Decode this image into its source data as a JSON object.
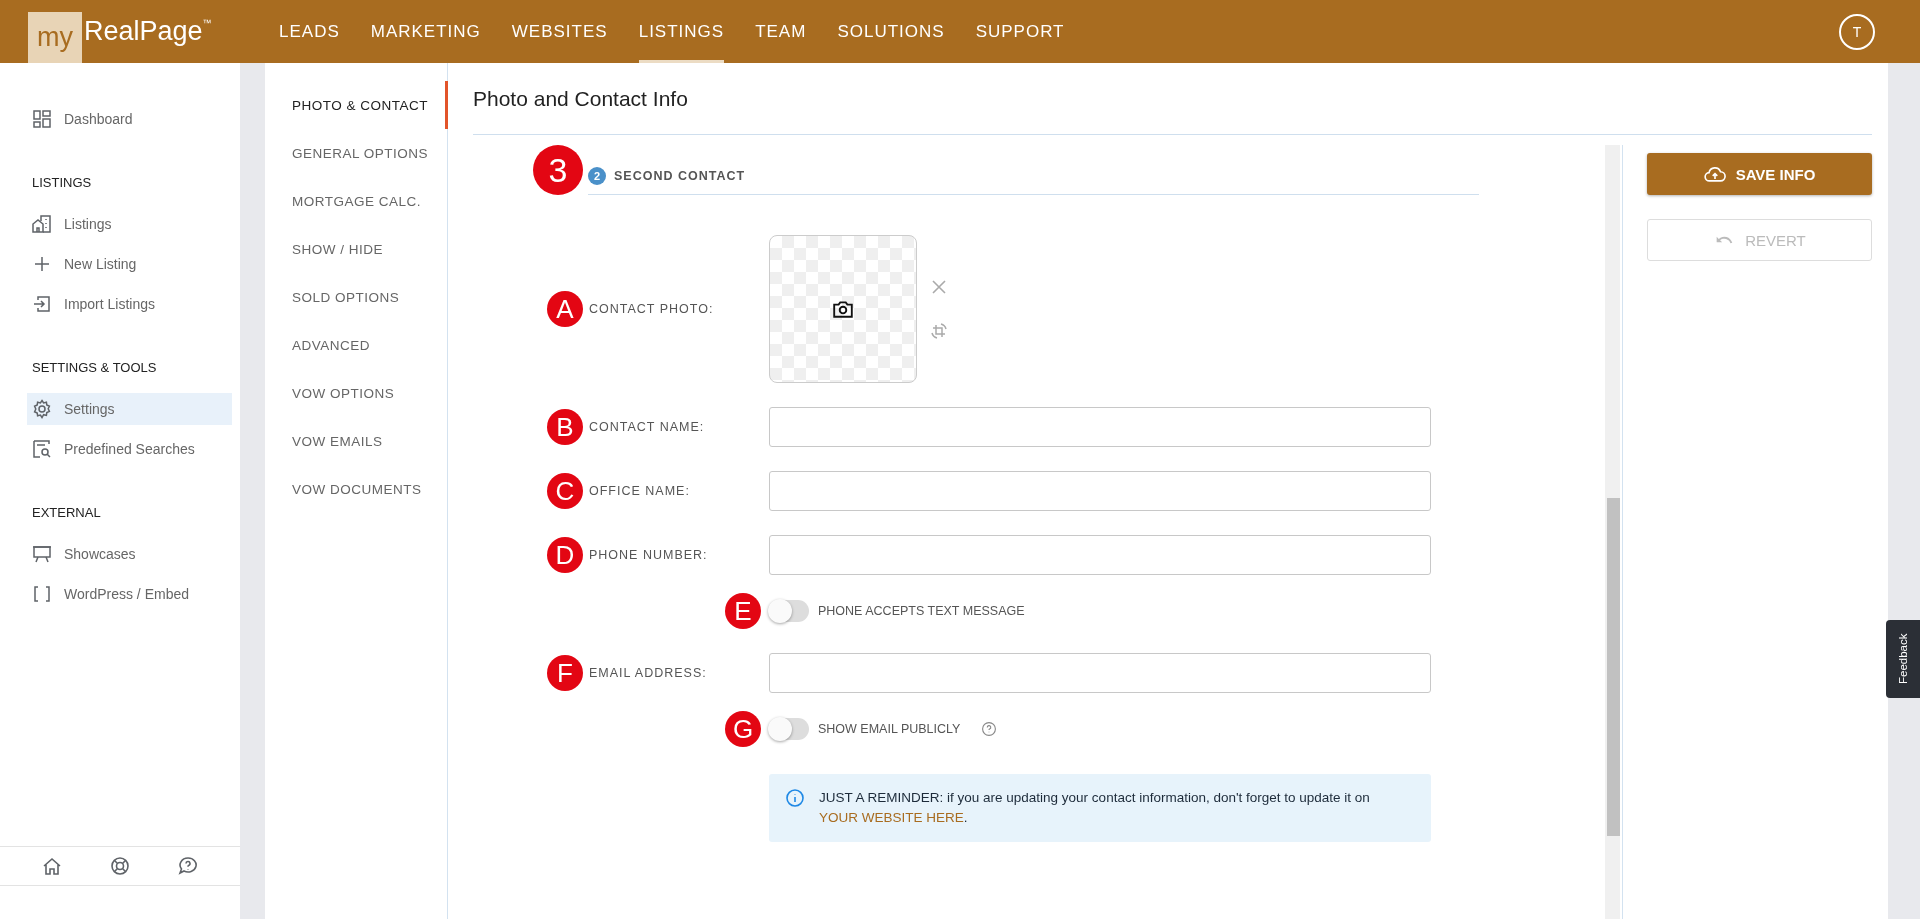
{
  "header": {
    "logo": {
      "prefix": "my",
      "name": "RealPage",
      "mark": "™"
    },
    "nav": [
      {
        "label": "LEADS",
        "selected": false
      },
      {
        "label": "MARKETING",
        "selected": false
      },
      {
        "label": "WEBSITES",
        "selected": false
      },
      {
        "label": "LISTINGS",
        "selected": true
      },
      {
        "label": "TEAM",
        "selected": false
      },
      {
        "label": "SOLUTIONS",
        "selected": false
      },
      {
        "label": "SUPPORT",
        "selected": false
      }
    ],
    "avatar": "T"
  },
  "sidebar": {
    "groups": [
      {
        "items": [
          {
            "label": "Dashboard",
            "kind": "dashboard",
            "selected": false
          }
        ]
      },
      {
        "title": "LISTINGS",
        "items": [
          {
            "label": "Listings",
            "kind": "buildings",
            "selected": false
          },
          {
            "label": "New Listing",
            "kind": "plus",
            "selected": false
          },
          {
            "label": "Import Listings",
            "kind": "import",
            "selected": false
          }
        ]
      },
      {
        "title": "SETTINGS & TOOLS",
        "items": [
          {
            "label": "Settings",
            "kind": "gear",
            "selected": true
          },
          {
            "label": "Predefined Searches",
            "kind": "searchlist",
            "selected": false
          }
        ]
      },
      {
        "title": "EXTERNAL",
        "items": [
          {
            "label": "Showcases",
            "kind": "easel",
            "selected": false
          },
          {
            "label": "WordPress / Embed",
            "kind": "brackets",
            "selected": false
          }
        ]
      }
    ]
  },
  "subnav": [
    {
      "label": "PHOTO & CONTACT",
      "selected": true
    },
    {
      "label": "GENERAL OPTIONS",
      "selected": false
    },
    {
      "label": "MORTGAGE CALC.",
      "selected": false
    },
    {
      "label": "SHOW / HIDE",
      "selected": false
    },
    {
      "label": "SOLD OPTIONS",
      "selected": false
    },
    {
      "label": "ADVANCED",
      "selected": false
    },
    {
      "label": "VOW OPTIONS",
      "selected": false
    },
    {
      "label": "VOW EMAILS",
      "selected": false
    },
    {
      "label": "VOW DOCUMENTS",
      "selected": false
    }
  ],
  "page_title": "Photo and Contact Info",
  "section": {
    "marker": "3",
    "number": "2",
    "title": "SECOND CONTACT"
  },
  "form": [
    {
      "kind": "photo",
      "marker": "A",
      "label": "CONTACT PHOTO:"
    },
    {
      "kind": "text",
      "marker": "B",
      "label": "CONTACT NAME:"
    },
    {
      "kind": "text",
      "marker": "C",
      "label": "OFFICE NAME:"
    },
    {
      "kind": "text",
      "marker": "D",
      "label": "PHONE NUMBER:"
    },
    {
      "kind": "toggle",
      "marker": "E",
      "label": "PHONE ACCEPTS TEXT MESSAGE",
      "on": false,
      "help": false
    },
    {
      "kind": "text",
      "marker": "F",
      "label": "EMAIL ADDRESS:"
    },
    {
      "kind": "toggle",
      "marker": "G",
      "label": "SHOW EMAIL PUBLICLY",
      "on": false,
      "help": true
    },
    {
      "kind": "notice",
      "text": "JUST A REMINDER: if you are updating your contact information, don't forget to update it on",
      "link": "YOUR WEBSITE HERE",
      "after": "."
    }
  ],
  "buttons": [
    {
      "label": "SAVE INFO",
      "kind": "primary",
      "disabled": false
    },
    {
      "label": "REVERT",
      "kind": "secondary",
      "disabled": true
    }
  ],
  "feedback": "Feedback"
}
